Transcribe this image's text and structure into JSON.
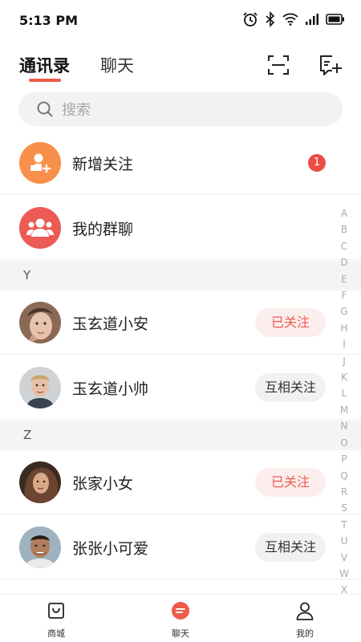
{
  "status_bar": {
    "time": "5:13 PM"
  },
  "header": {
    "tabs": [
      {
        "label": "通讯录",
        "active": true
      },
      {
        "label": "聊天",
        "active": false
      }
    ]
  },
  "search": {
    "placeholder": "搜索"
  },
  "fixed_items": [
    {
      "label": "新增关注",
      "badge": "1",
      "icon": "add-user-icon",
      "color": "#f7904a"
    },
    {
      "label": "我的群聊",
      "icon": "group-icon",
      "color": "#ec5a55"
    }
  ],
  "sections": [
    {
      "letter": "Y",
      "contacts": [
        {
          "name": "玉玄道小安",
          "status": "已关注"
        },
        {
          "name": "玉玄道小帅",
          "status": "互相关注"
        }
      ]
    },
    {
      "letter": "Z",
      "contacts": [
        {
          "name": "张家小女",
          "status": "已关注"
        },
        {
          "name": "张张小可爱",
          "status": "互相关注"
        }
      ]
    }
  ],
  "alphabet": [
    "A",
    "B",
    "C",
    "D",
    "E",
    "F",
    "G",
    "H",
    "I",
    "J",
    "K",
    "L",
    "M",
    "N",
    "O",
    "P",
    "Q",
    "R",
    "S",
    "T",
    "U",
    "V",
    "W",
    "X"
  ],
  "bottom_tabs": [
    {
      "label": "商城",
      "icon": "shop-bag-icon"
    },
    {
      "label": "聊天",
      "icon": "chat-icon",
      "active": true
    },
    {
      "label": "我的",
      "icon": "profile-icon"
    }
  ],
  "colors": {
    "accent": "#f05a4a",
    "followed_bg": "#fdeeee",
    "mutual_bg": "#f1f1f1"
  }
}
